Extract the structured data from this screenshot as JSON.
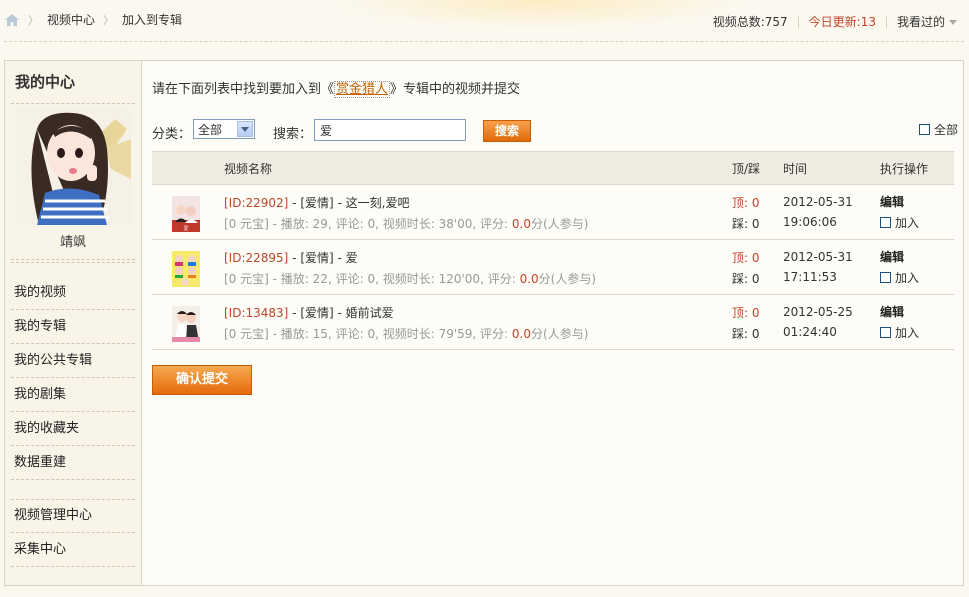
{
  "breadcrumb": {
    "items": [
      "视频中心",
      "加入到专辑"
    ]
  },
  "stats": {
    "total_label": "视频总数: ",
    "total": "757",
    "today_label": "今日更新: ",
    "today": "13",
    "history": "我看过的"
  },
  "sidebar": {
    "title": "我的中心",
    "username": "靖飒",
    "nav": [
      "我的视频",
      "我的专辑",
      "我的公共专辑",
      "我的剧集",
      "我的收藏夹",
      "数据重建"
    ],
    "nav2": [
      "视频管理中心",
      "采集中心"
    ]
  },
  "main": {
    "intro_before": "请在下面列表中找到要加入到《",
    "album": "赏金猎人",
    "intro_after": "》专辑中的视频并提交",
    "filter": {
      "category_label": "分类：",
      "category": "全部",
      "search_label": "搜索：",
      "search_value": "爱",
      "search_button": "搜索",
      "all_label": "全部"
    },
    "table": {
      "headers": {
        "name": "视频名称",
        "votes": "顶/踩",
        "time": "时间",
        "actions": "执行操作"
      },
      "rows": [
        {
          "id": "[ID:22902]",
          "cat": "[爱情]",
          "title": "这一刻,爱吧",
          "price": "[0 元宝]",
          "plays": "29",
          "comments": "0",
          "duration": "38'00",
          "score": "0.0",
          "up": "顶: 0",
          "down": "踩: 0",
          "date": "2012-05-31",
          "time": "19:06:06",
          "edit": "编辑",
          "join": "加入"
        },
        {
          "id": "[ID:22895]",
          "cat": "[爱情]",
          "title": "爱",
          "price": "[0 元宝]",
          "plays": "22",
          "comments": "0",
          "duration": "120'00",
          "score": "0.0",
          "up": "顶: 0",
          "down": "踩: 0",
          "date": "2012-05-31",
          "time": "17:11:53",
          "edit": "编辑",
          "join": "加入"
        },
        {
          "id": "[ID:13483]",
          "cat": "[爱情]",
          "title": "婚前试爱",
          "price": "[0 元宝]",
          "plays": "15",
          "comments": "0",
          "duration": "79'59",
          "score": "0.0",
          "up": "顶: 0",
          "down": "踩: 0",
          "date": "2012-05-25",
          "time": "01:24:40",
          "edit": "编辑",
          "join": "加入"
        }
      ],
      "labels": {
        "plays": " - 播放: ",
        "comments": ", 评论: ",
        "duration": ", 视频时长: ",
        "score": ", 评分: ",
        "score_unit": "分(人参与)",
        "dash": " - "
      }
    },
    "confirm_button": "确认提交"
  }
}
